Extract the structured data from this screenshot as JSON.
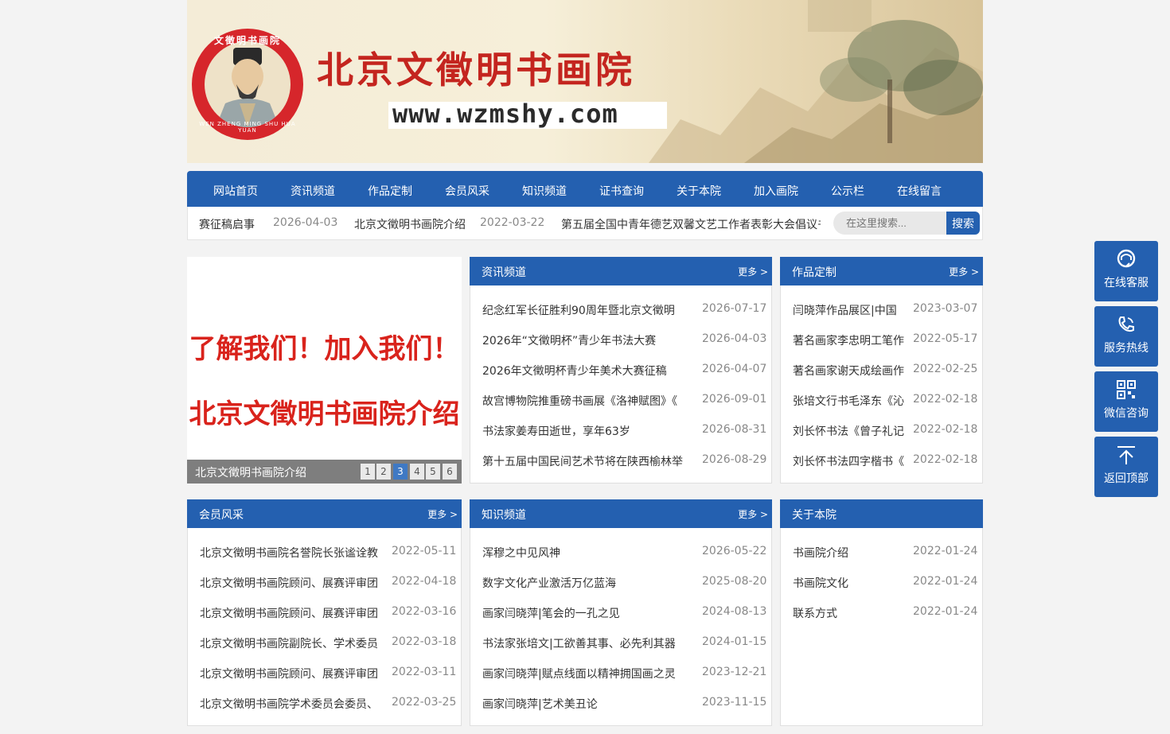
{
  "banner": {
    "title": "北京文徵明书画院",
    "url": "www.wzmshy.com",
    "seal_top": "文徵明书画院",
    "seal_bottom": "WEN ZHENG MING SHU HUA YUAN"
  },
  "nav": [
    "网站首页",
    "资讯频道",
    "作品定制",
    "会员风采",
    "知识频道",
    "证书查询",
    "关于本院",
    "加入画院",
    "公示栏",
    "在线留言"
  ],
  "ticker": [
    {
      "title": "赛征稿启事",
      "date": "2026-04-03"
    },
    {
      "title": "北京文徵明书画院介绍",
      "date": "2022-03-22"
    },
    {
      "title": "第五届全国中青年德艺双馨文艺工作者表彰大会倡议书",
      "date": ""
    }
  ],
  "search": {
    "placeholder": "在这里搜索...",
    "button": "搜索"
  },
  "slider": {
    "line1": "了解我们！加入我们！",
    "line2": "北京文徵明书画院介绍",
    "caption": "北京文徵明书画院介绍",
    "pages": [
      "1",
      "2",
      "3",
      "4",
      "5",
      "6"
    ],
    "active_page": 3
  },
  "panels": {
    "news": {
      "title": "资讯频道",
      "more": "更多 >",
      "items": [
        {
          "title": "纪念红军长征胜利90周年暨北京文徵明",
          "date": "2026-07-17"
        },
        {
          "title": "2026年“文徵明杯”青少年书法大赛",
          "date": "2026-04-03"
        },
        {
          "title": "2026年文徵明杯青少年美术大赛征稿",
          "date": "2026-04-07"
        },
        {
          "title": "故宫博物院推重磅书画展《洛神赋图》《",
          "date": "2026-09-01"
        },
        {
          "title": "书法家姜寿田逝世，享年63岁",
          "date": "2026-08-31"
        },
        {
          "title": "第十五届中国民间艺术节将在陕西榆林举",
          "date": "2026-08-29"
        }
      ]
    },
    "works": {
      "title": "作品定制",
      "more": "更多 >",
      "items": [
        {
          "title": "闫晓萍作品展区|中国",
          "date": "2023-03-07"
        },
        {
          "title": "著名画家李忠明工笔作",
          "date": "2022-05-17"
        },
        {
          "title": "著名画家谢天成绘画作",
          "date": "2022-02-25"
        },
        {
          "title": "张培文行书毛泽东《沁",
          "date": "2022-02-18"
        },
        {
          "title": "刘长怀书法《曾子礼记",
          "date": "2022-02-18"
        },
        {
          "title": "刘长怀书法四字楷书《",
          "date": "2022-02-18"
        }
      ]
    },
    "members": {
      "title": "会员风采",
      "more": "更多 >",
      "items": [
        {
          "title": "北京文徵明书画院名誉院长张谧诠教",
          "date": "2022-05-11"
        },
        {
          "title": "北京文徵明书画院顾问、展赛评审团",
          "date": "2022-04-18"
        },
        {
          "title": "北京文徵明书画院顾问、展赛评审团",
          "date": "2022-03-16"
        },
        {
          "title": "北京文徵明书画院副院长、学术委员",
          "date": "2022-03-18"
        },
        {
          "title": "北京文徵明书画院顾问、展赛评审团",
          "date": "2022-03-11"
        },
        {
          "title": "北京文徵明书画院学术委员会委员、",
          "date": "2022-03-25"
        }
      ]
    },
    "knowledge": {
      "title": "知识频道",
      "more": "更多 >",
      "items": [
        {
          "title": "浑穆之中见风神",
          "date": "2026-05-22"
        },
        {
          "title": "数字文化产业激活万亿蓝海",
          "date": "2025-08-20"
        },
        {
          "title": "画家闫晓萍|笔会的一孔之见",
          "date": "2024-08-13"
        },
        {
          "title": "书法家张培文|工欲善其事、必先利其器",
          "date": "2024-01-15"
        },
        {
          "title": "画家闫晓萍|赋点线面以精神拥国画之灵",
          "date": "2023-12-21"
        },
        {
          "title": "画家闫晓萍|艺术美丑论",
          "date": "2023-11-15"
        }
      ]
    },
    "about": {
      "title": "关于本院",
      "items": [
        {
          "title": "书画院介绍",
          "date": "2022-01-24"
        },
        {
          "title": "书画院文化",
          "date": "2022-01-24"
        },
        {
          "title": "联系方式",
          "date": "2022-01-24"
        }
      ]
    }
  },
  "side_tools": [
    "在线客服",
    "服务热线",
    "微信咨询",
    "返回顶部"
  ],
  "colors": {
    "brand_blue": "#2460b0",
    "title_red": "#c4251f",
    "slide_red": "#d9231c"
  }
}
